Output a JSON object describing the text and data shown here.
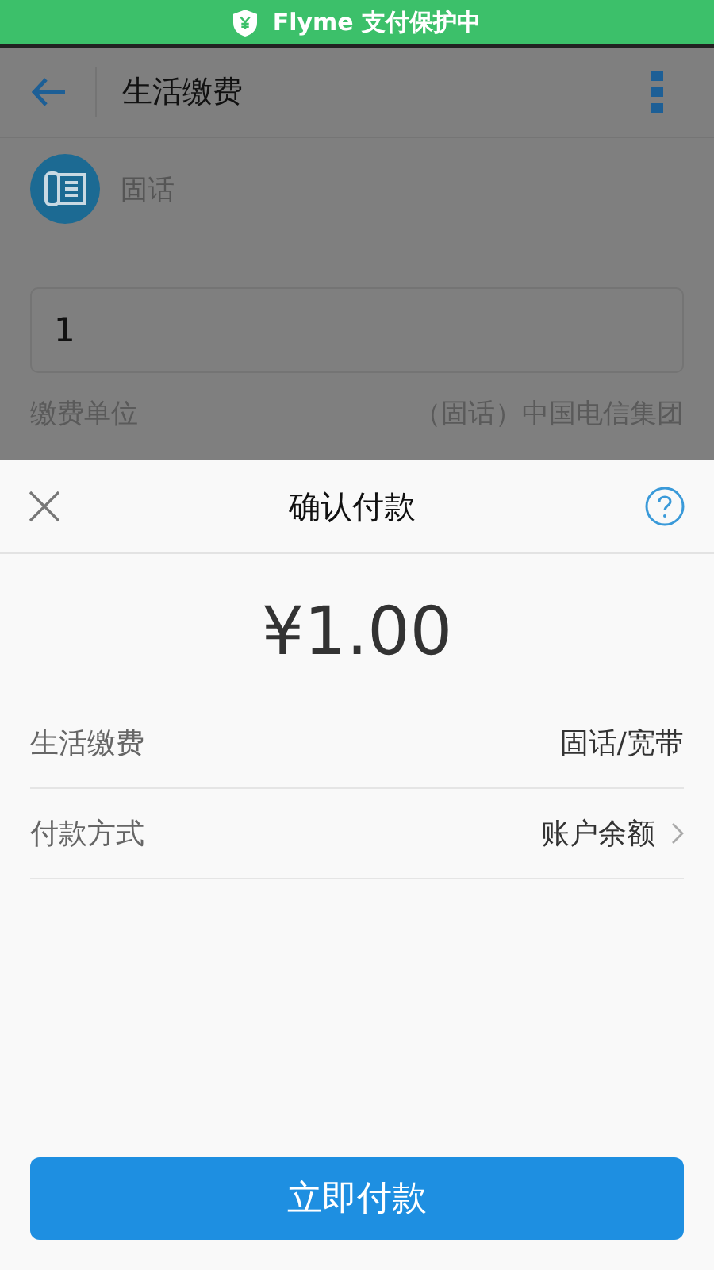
{
  "status_bar": {
    "text": "Flyme 支付保护中"
  },
  "app_bar": {
    "title": "生活缴费"
  },
  "service": {
    "label": "固话"
  },
  "account_field": {
    "value": "1"
  },
  "unit_row": {
    "label": "缴费单位",
    "value": "（固话）中国电信集团"
  },
  "sheet": {
    "title": "确认付款",
    "amount": "¥1.00",
    "rows": [
      {
        "label": "生活缴费",
        "value": "固话/宽带",
        "kind": "info"
      },
      {
        "label": "付款方式",
        "value": "账户余额",
        "kind": "link"
      }
    ],
    "pay_button": "立即付款"
  }
}
